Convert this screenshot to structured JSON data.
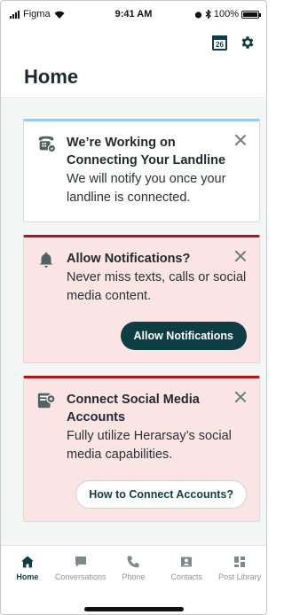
{
  "status_bar": {
    "carrier": "Figma",
    "time": "9:41 AM",
    "battery": "100%"
  },
  "header": {
    "title": "Home",
    "calendar_day": "26"
  },
  "cards": {
    "landline": {
      "title": "We’re Working on Connecting Your Landline",
      "body": "We will notify you once your landline is connected."
    },
    "notifications": {
      "title": "Allow Notifications?",
      "body": "Never miss texts, calls or social media content.",
      "button": "Allow Notifications"
    },
    "social": {
      "title": "Connect Social Media Accounts",
      "body": "Fully utilize Herarsay’s social media capabilities.",
      "button": "How to Connect Accounts?"
    }
  },
  "tabs": [
    {
      "label": "Home",
      "icon": "home-icon"
    },
    {
      "label": "Conversations",
      "icon": "chat-icon"
    },
    {
      "label": "Phone",
      "icon": "phone-icon"
    },
    {
      "label": "Contacts",
      "icon": "contacts-icon"
    },
    {
      "label": "Post Library",
      "icon": "grid-icon"
    }
  ],
  "colors": {
    "brand_dark": "#0e3e44",
    "alert_red": "#b3131b",
    "alert_bg": "#fbe4e4",
    "info_blue": "#92ccee"
  }
}
